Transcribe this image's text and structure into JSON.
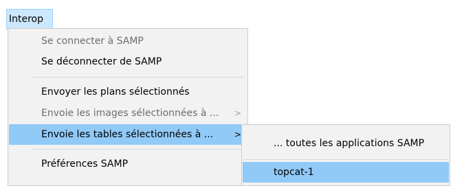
{
  "menubar": {
    "active_menu": "Interop"
  },
  "menu": {
    "items": [
      {
        "label": "Se connecter à SAMP",
        "enabled": false
      },
      {
        "label": "Se déconnecter de SAMP",
        "enabled": true
      },
      {
        "label": "Envoyer les plans sélectionnés",
        "enabled": true
      },
      {
        "label": "Envoie les images sélectionnées à ...",
        "enabled": false,
        "submenu_arrow": ">"
      },
      {
        "label": "Envoie les tables sélectionnées à ...",
        "enabled": true,
        "highlighted": true,
        "submenu_arrow": ">"
      },
      {
        "label": "Préférences SAMP",
        "enabled": true
      }
    ]
  },
  "submenu": {
    "items": [
      {
        "label": "... toutes les applications SAMP",
        "enabled": true
      },
      {
        "label": "topcat-1",
        "enabled": true,
        "highlighted": true
      }
    ]
  },
  "colors": {
    "menubar_active_bg": "#cce8ff",
    "menu_bg": "#f2f2f2",
    "highlight_bg": "#91c9f7",
    "disabled_text": "#6d6d6d"
  }
}
